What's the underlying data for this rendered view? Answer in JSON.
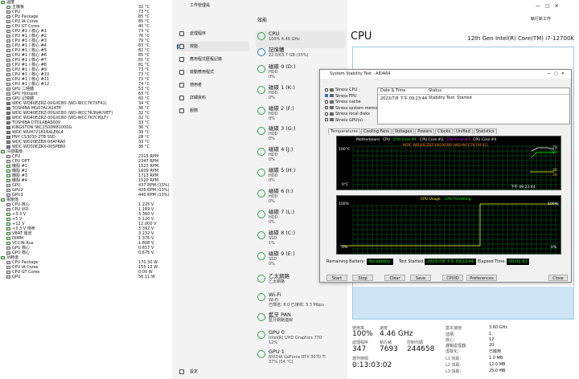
{
  "sensors": [
    {
      "type": "head",
      "label": "溫度"
    },
    {
      "type": "item",
      "label": "主機板",
      "value": "32 °C"
    },
    {
      "type": "item",
      "label": "CPU",
      "value": "73 °C"
    },
    {
      "type": "item",
      "label": "CPU Package",
      "value": "85 °C"
    },
    {
      "type": "item",
      "label": "CPU IA Cores",
      "value": "85 °C"
    },
    {
      "type": "item",
      "label": "CPU GT Cores",
      "value": "40 °C"
    },
    {
      "type": "item",
      "label": "CPU #1 / 核心 #1",
      "value": "73 °C"
    },
    {
      "type": "item",
      "label": "CPU #1 / 核心 #2",
      "value": "76 °C"
    },
    {
      "type": "item",
      "label": "CPU #1 / 核心 #3",
      "value": "79 °C"
    },
    {
      "type": "item",
      "label": "CPU #1 / 核心 #4",
      "value": "83 °C"
    },
    {
      "type": "item",
      "label": "CPU #1 / 核心 #5",
      "value": "82 °C"
    },
    {
      "type": "item",
      "label": "CPU #1 / 核心 #6",
      "value": "85 °C"
    },
    {
      "type": "item",
      "label": "CPU #1 / 核心 #7",
      "value": "81 °C"
    },
    {
      "type": "item",
      "label": "CPU #1 / 核心 #8",
      "value": "81 °C"
    },
    {
      "type": "item",
      "label": "CPU #1 / 核心 #9",
      "value": "73 °C"
    },
    {
      "type": "item",
      "label": "CPU #1 / 核心 #10",
      "value": "73 °C"
    },
    {
      "type": "item",
      "label": "CPU #1 / 核心 #11",
      "value": "73 °C"
    },
    {
      "type": "item",
      "label": "CPU #1 / 核心 #12",
      "value": "74 °C"
    },
    {
      "type": "item",
      "label": "GPU 二極體",
      "value": "53 °C"
    },
    {
      "type": "item",
      "label": "GPU Hotspot",
      "value": "63 °C"
    },
    {
      "type": "item",
      "label": "GPU 記憶體",
      "value": "60 °C"
    },
    {
      "type": "item",
      "label": "WDC WD40EZRZ-00GXCB0 (WD-WCC7K7XF41)",
      "value": "34 °C"
    },
    {
      "type": "item",
      "label": "TOSHIBA MG07ACA14TE",
      "value": "36 °C"
    },
    {
      "type": "item",
      "label": "WDC WD40EZRZ-00GXCB0 (WD-WCC7K3N4UVET)",
      "value": "32 °C"
    },
    {
      "type": "item",
      "label": "WDC WD40EZRZ-00GXCB0 (WD-WCC7K7CHJLT)",
      "value": "32 °C"
    },
    {
      "type": "item",
      "label": "TOSHIBA DT01ABA300V",
      "value": "33 °C"
    },
    {
      "type": "item",
      "label": "KINGSTON SKC2500M81000G",
      "value": "36 °C"
    },
    {
      "type": "item",
      "label": "WDC WUH721616ALE6L4",
      "value": "39 °C"
    },
    {
      "type": "item",
      "label": "PNY CS3030 2TB SSD",
      "value": "28 °C"
    },
    {
      "type": "item",
      "label": "WDC WD20EZBX-00AYRA0",
      "value": "33 °C"
    },
    {
      "type": "item",
      "label": "WDC WD30EZRX-00SPEB0",
      "value": "36 °C"
    },
    {
      "type": "head",
      "label": "冷卻風扇"
    },
    {
      "type": "item",
      "label": "CPU",
      "value": "2315 RPM"
    },
    {
      "type": "item",
      "label": "CPU OPT",
      "value": "2347 RPM"
    },
    {
      "type": "item",
      "label": "機殼 #1",
      "value": "1523 RPM"
    },
    {
      "type": "item",
      "label": "機殼 #2",
      "value": "1609 RPM"
    },
    {
      "type": "item",
      "label": "機殼 #3",
      "value": "1713 RPM"
    },
    {
      "type": "item",
      "label": "機殼 #4",
      "value": "1520 RPM"
    },
    {
      "type": "item",
      "label": "GPU",
      "value": "437 RPM (13%)"
    },
    {
      "type": "item",
      "label": "GPU2",
      "value": "435 RPM (13%)"
    },
    {
      "type": "item",
      "label": "GPU3",
      "value": "440 RPM (13%)"
    },
    {
      "type": "head",
      "label": "電壓值"
    },
    {
      "type": "item",
      "label": "CPU 核心",
      "value": "1.225 V"
    },
    {
      "type": "item",
      "label": "CPU VID",
      "value": "1.169 V"
    },
    {
      "type": "item",
      "label": "+3.3 V",
      "value": "3.360 V"
    },
    {
      "type": "item",
      "label": "+5 V",
      "value": "5.120 V"
    },
    {
      "type": "item",
      "label": "+12 V",
      "value": "12.000 V"
    },
    {
      "type": "item",
      "label": "+3.3 V 待命",
      "value": "3.392 V"
    },
    {
      "type": "item",
      "label": "VBAT 電池",
      "value": "3.232 V"
    },
    {
      "type": "item",
      "label": "DIMM",
      "value": "1.376 V"
    },
    {
      "type": "item",
      "label": "VCCIN Aux",
      "value": "1.808 V"
    },
    {
      "type": "item",
      "label": "GPU 核心",
      "value": "0.657 V"
    },
    {
      "type": "item",
      "label": "GPU 核心",
      "value": "0.675 V"
    },
    {
      "type": "head",
      "label": "功耗值"
    },
    {
      "type": "item",
      "label": "CPU Package",
      "value": "170.30 W"
    },
    {
      "type": "item",
      "label": "CPU IA Cores",
      "value": "155.12 W"
    },
    {
      "type": "item",
      "label": "CPU GT Cores",
      "value": "0.00 W"
    },
    {
      "type": "item",
      "label": "GPU",
      "value": "56.11 W"
    }
  ],
  "taskmgr": {
    "title": "工作管理員",
    "new_task": "執行新工作",
    "nav": [
      {
        "label": "處理程序"
      },
      {
        "label": "效能"
      },
      {
        "label": "應用程式歷程記錄"
      },
      {
        "label": "啟動應用程式"
      },
      {
        "label": "使用者"
      },
      {
        "label": "詳細資料"
      },
      {
        "label": "服務"
      }
    ],
    "settings": "設定",
    "perf_header": "效能",
    "perf_items": [
      {
        "title": "CPU",
        "l2": "100% 4.46 GHz",
        "l3": ""
      },
      {
        "title": "記憶體",
        "l2": "22.0/63.7 GB (35%)",
        "l3": ""
      },
      {
        "title": "磁碟 0 (D:)",
        "l2": "HDD",
        "l3": "0%"
      },
      {
        "title": "磁碟 1 (K:)",
        "l2": "HDD",
        "l3": "0%"
      },
      {
        "title": "磁碟 2 (F:)",
        "l2": "HDD",
        "l3": "0%"
      },
      {
        "title": "磁碟 3 (G:)",
        "l2": "HDD",
        "l3": "0%"
      },
      {
        "title": "磁碟 4 (J:)",
        "l2": "HDD",
        "l3": "0%"
      },
      {
        "title": "磁碟 5 (H:)",
        "l2": "HDD",
        "l3": "0%"
      },
      {
        "title": "磁碟 6 (I:)",
        "l2": "HDD",
        "l3": "0%"
      },
      {
        "title": "磁碟 7 (L:)",
        "l2": "HDD",
        "l3": "0%"
      },
      {
        "title": "磁碟 8 (C:)",
        "l2": "SSD",
        "l3": "1%"
      },
      {
        "title": "磁碟 9 (E:)",
        "l2": "SSD",
        "l3": "0%"
      },
      {
        "title": "乙太網路",
        "l2": "乙太網路",
        "l3": ""
      },
      {
        "title": "Wi-Fi",
        "l2": "Wi-Fi",
        "l3": "已傳送: 8.0 已接收: 5.3 Mbps"
      },
      {
        "title": "藍牙 PAN",
        "l2": "藍牙網路連線",
        "l3": ""
      },
      {
        "title": "GPU 0",
        "l2": "Intel(R) UHD Graphics 770",
        "l3": "12%"
      },
      {
        "title": "GPU 1",
        "l2": "NVIDIA GeForce RTX 3070 Ti",
        "l3": "37% (54 °C)"
      }
    ],
    "cpu": {
      "heading": "CPU",
      "model": "12th Gen Intel(R) Core(TM) i7-12700K",
      "util_label": "使用率",
      "util": "100%",
      "speed_label": "速度",
      "speed": "4.46 GHz",
      "proc_label": "處理程序",
      "proc": "347",
      "thread_label": "執行緒",
      "thread": "7693",
      "handle_label": "控制代碼",
      "handle": "244658",
      "uptime_label": "運作時間",
      "uptime": "0:13:03:02",
      "base_label": "基本速度:",
      "base": "3.60 GHz",
      "sockets_label": "插槽:",
      "sockets": "1",
      "cores_label": "核心:",
      "cores": "12",
      "lp_label": "邏輯處理器:",
      "lp": "20",
      "virt_label": "虛擬化:",
      "virt": "已啟用",
      "l1_label": "L1 快取:",
      "l1": "1.0 MB",
      "l2_label": "L2 快取:",
      "l2": "12.0 MB",
      "l3_label": "L3 快取:",
      "l3": "25.0 MB"
    }
  },
  "aida": {
    "title": "System Stability Test - AIDA64",
    "stress": [
      {
        "label": "Stress CPU",
        "on": false
      },
      {
        "label": "Stress FPU",
        "on": true
      },
      {
        "label": "Stress cache",
        "on": false
      },
      {
        "label": "Stress system memory",
        "on": false
      },
      {
        "label": "Stress local disks",
        "on": false
      },
      {
        "label": "Stress GPU(s)",
        "on": false
      }
    ],
    "log_head": {
      "c1": "Date & Time",
      "c2": "Status"
    },
    "log_row": {
      "c1": "2023/7/8 下午 09:23:44",
      "c2": "Stability Test: Started"
    },
    "tabs": [
      "Temperatures",
      "Cooling Fans",
      "Voltages",
      "Powers",
      "Clocks",
      "Unified",
      "Statistics"
    ],
    "temp_legend": [
      {
        "label": "Motherboard",
        "color": "#ffffff"
      },
      {
        "label": "CPU",
        "color": "#ffffff"
      },
      {
        "label": "CPU Core #1",
        "color": "#00ff00"
      },
      {
        "label": "CPU Core #2",
        "color": "#ffffff"
      },
      {
        "label": "CPU Core #3",
        "color": "#ff00ff"
      },
      {
        "label": "CPU Core #4",
        "color": "#ffffff"
      }
    ],
    "temp_legend2": "WDC WD40EZRZ-00GXCB0 (WD-WCC7K7XF41)",
    "temp_top": "100°C",
    "temp_bot": "0°C",
    "temp_time": "下午 09:23:44",
    "temp_r1": "73",
    "temp_r2": "82",
    "temp_r3": "32",
    "temp_r4": "34",
    "usage_title_a": "CPU Usage",
    "usage_title_b": "CPU Throttling",
    "usage_top": "100%",
    "usage_bot": "0%",
    "usage_r1": "100%",
    "usage_r2": "0%",
    "battery_label": "Remaining Battery:",
    "battery": "No battery",
    "started_label": "Test Started:",
    "started": "2023/7/8 下午 09:23:44",
    "elapsed_label": "Elapsed Time:",
    "elapsed": "00:01:42",
    "buttons": [
      "Start",
      "Stop",
      "Clear",
      "Save",
      "CPUID",
      "Preferences",
      "Close"
    ]
  }
}
